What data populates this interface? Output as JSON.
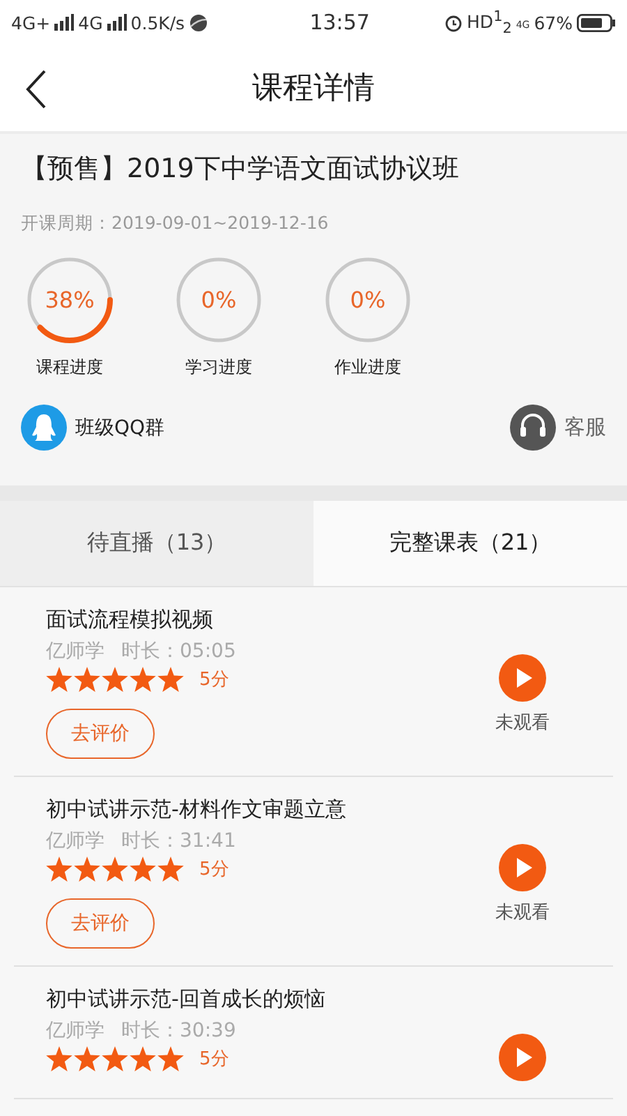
{
  "status_bar": {
    "network_1": "4G+",
    "network_2": "4G",
    "speed": "0.5K/s",
    "time": "13:57",
    "hd": "HD$^{1}$$_{2}$",
    "network_3": "4G",
    "battery": "67%"
  },
  "header": {
    "title": "课程详情"
  },
  "course": {
    "title": "【预售】2019下中学语文面试协议班",
    "period": "开课周期：2019-09-01~2019-12-16",
    "progress": [
      {
        "reading": "38%",
        "label": "课程进度",
        "level": 0.38
      },
      {
        "reading": "0%",
        "label": "学习进度",
        "level": 0
      },
      {
        "reading": "0%",
        "label": "作业进度",
        "level": 0
      }
    ],
    "qq_group": "班级QQ群",
    "service": "客服"
  },
  "tabs": [
    {
      "label": "待直播（13）",
      "selected": false
    },
    {
      "label": "完整课表（21）",
      "selected": true
    }
  ],
  "lessons": [
    {
      "title": "面试流程模拟视频",
      "teacher": "亿师学",
      "duration": "时长：05:05",
      "stars": 5,
      "score": "5分",
      "status": "未观看",
      "action": "去评价"
    },
    {
      "title": "初中试讲示范-材料作文审题立意",
      "teacher": "亿师学",
      "duration": "时长：31:41",
      "stars": 5,
      "score": "5分",
      "status": "未观看",
      "action": "去评价"
    },
    {
      "title": "初中试讲示范-回首成长的烦恼",
      "teacher": "亿师学",
      "duration": "时长：30:39",
      "stars": 5,
      "score": "5分"
    }
  ]
}
